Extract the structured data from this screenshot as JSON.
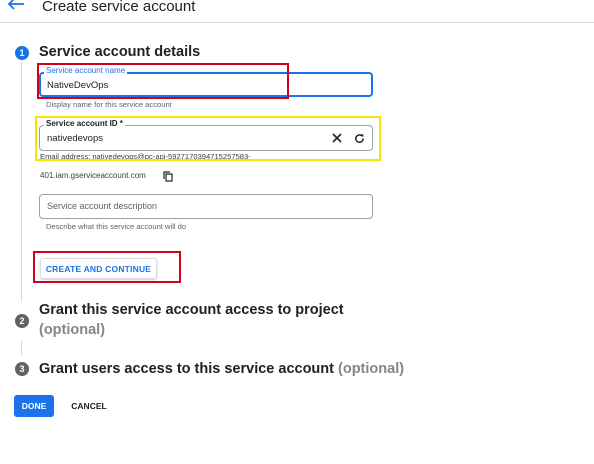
{
  "header": {
    "title": "Create service account"
  },
  "steps": [
    {
      "number": "1",
      "title": "Service account details"
    },
    {
      "number": "2",
      "title": "Grant this service account access to project",
      "optional": "(optional)"
    },
    {
      "number": "3",
      "title": "Grant users access to this service account",
      "optional": "(optional)"
    }
  ],
  "form": {
    "name": {
      "label": "Service account name",
      "value": "NativeDevOps",
      "helper": "Display name for this service account"
    },
    "id": {
      "label": "Service account ID *",
      "value": "nativedevops",
      "email_line1": "Email address: nativedevops@pc-api-5927170394715257583-",
      "email_line2": "401.iam.gserviceaccount.com"
    },
    "description": {
      "placeholder": "Service account description",
      "helper": "Describe what this service account will do"
    }
  },
  "buttons": {
    "create_continue": "CREATE AND CONTINUE",
    "done": "DONE",
    "cancel": "CANCEL"
  },
  "colors": {
    "accent": "#1a73e8",
    "highlight_red": "#d0021b",
    "highlight_yellow": "#f5e400",
    "step_inactive": "#5f6368"
  },
  "icons": {
    "back": "arrow-left-icon",
    "clear": "close-icon",
    "refresh": "refresh-icon",
    "copy": "copy-icon"
  }
}
